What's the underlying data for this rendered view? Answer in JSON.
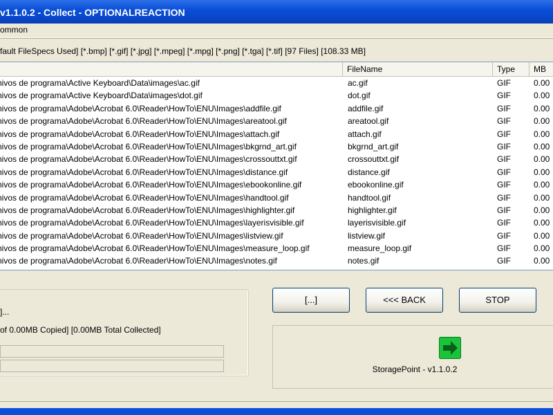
{
  "window": {
    "title": "v1.1.0.2 - Collect - OPTIONALREACTION"
  },
  "menu": {
    "label": "ommon"
  },
  "specs": {
    "text": "fault FileSpecs Used] [*.bmp] [*.gif] [*.jpg] [*.mpeg] [*.mpg] [*.png] [*.tga] [*.tif] [97 Files] [108.33 MB]"
  },
  "list": {
    "columns": {
      "path": "",
      "filename": "FileName",
      "type": "Type",
      "mb": "MB"
    },
    "rows": [
      {
        "path": "hivos de programa\\Active Keyboard\\Data\\images\\ac.gif",
        "filename": "ac.gif",
        "type": "GIF",
        "mb": "0.00"
      },
      {
        "path": "hivos de programa\\Active Keyboard\\Data\\images\\dot.gif",
        "filename": "dot.gif",
        "type": "GIF",
        "mb": "0.00"
      },
      {
        "path": "hivos de programa\\Adobe\\Acrobat 6.0\\Reader\\HowTo\\ENU\\Images\\addfile.gif",
        "filename": "addfile.gif",
        "type": "GIF",
        "mb": "0.00"
      },
      {
        "path": "hivos de programa\\Adobe\\Acrobat 6.0\\Reader\\HowTo\\ENU\\Images\\areatool.gif",
        "filename": "areatool.gif",
        "type": "GIF",
        "mb": "0.00"
      },
      {
        "path": "hivos de programa\\Adobe\\Acrobat 6.0\\Reader\\HowTo\\ENU\\Images\\attach.gif",
        "filename": "attach.gif",
        "type": "GIF",
        "mb": "0.00"
      },
      {
        "path": "hivos de programa\\Adobe\\Acrobat 6.0\\Reader\\HowTo\\ENU\\Images\\bkgrnd_art.gif",
        "filename": "bkgrnd_art.gif",
        "type": "GIF",
        "mb": "0.00"
      },
      {
        "path": "hivos de programa\\Adobe\\Acrobat 6.0\\Reader\\HowTo\\ENU\\Images\\crossouttxt.gif",
        "filename": "crossouttxt.gif",
        "type": "GIF",
        "mb": "0.00"
      },
      {
        "path": "hivos de programa\\Adobe\\Acrobat 6.0\\Reader\\HowTo\\ENU\\Images\\distance.gif",
        "filename": "distance.gif",
        "type": "GIF",
        "mb": "0.00"
      },
      {
        "path": "hivos de programa\\Adobe\\Acrobat 6.0\\Reader\\HowTo\\ENU\\Images\\ebookonline.gif",
        "filename": "ebookonline.gif",
        "type": "GIF",
        "mb": "0.00"
      },
      {
        "path": "hivos de programa\\Adobe\\Acrobat 6.0\\Reader\\HowTo\\ENU\\Images\\handtool.gif",
        "filename": "handtool.gif",
        "type": "GIF",
        "mb": "0.00"
      },
      {
        "path": "hivos de programa\\Adobe\\Acrobat 6.0\\Reader\\HowTo\\ENU\\Images\\highlighter.gif",
        "filename": "highlighter.gif",
        "type": "GIF",
        "mb": "0.00"
      },
      {
        "path": "hivos de programa\\Adobe\\Acrobat 6.0\\Reader\\HowTo\\ENU\\Images\\layerisvisible.gif",
        "filename": "layerisvisible.gif",
        "type": "GIF",
        "mb": "0.00"
      },
      {
        "path": "hivos de programa\\Adobe\\Acrobat 6.0\\Reader\\HowTo\\ENU\\Images\\listview.gif",
        "filename": "listview.gif",
        "type": "GIF",
        "mb": "0.00"
      },
      {
        "path": "hivos de programa\\Adobe\\Acrobat 6.0\\Reader\\HowTo\\ENU\\Images\\measure_loop.gif",
        "filename": "measure_loop.gif",
        "type": "GIF",
        "mb": "0.00"
      },
      {
        "path": "hivos de programa\\Adobe\\Acrobat 6.0\\Reader\\HowTo\\ENU\\Images\\notes.gif",
        "filename": "notes.gif",
        "type": "GIF",
        "mb": "0.00"
      }
    ]
  },
  "status": {
    "line1": "]...",
    "line2": "of 0.00MB Copied] [0.00MB Total Collected]"
  },
  "buttons": {
    "browse": "[...]",
    "back": "<<< BACK",
    "stop": "STOP"
  },
  "brand": {
    "label": "StoragePoint - v1.1.0.2",
    "icon": "green-arrow-icon",
    "icon_color": "#19c43a"
  }
}
